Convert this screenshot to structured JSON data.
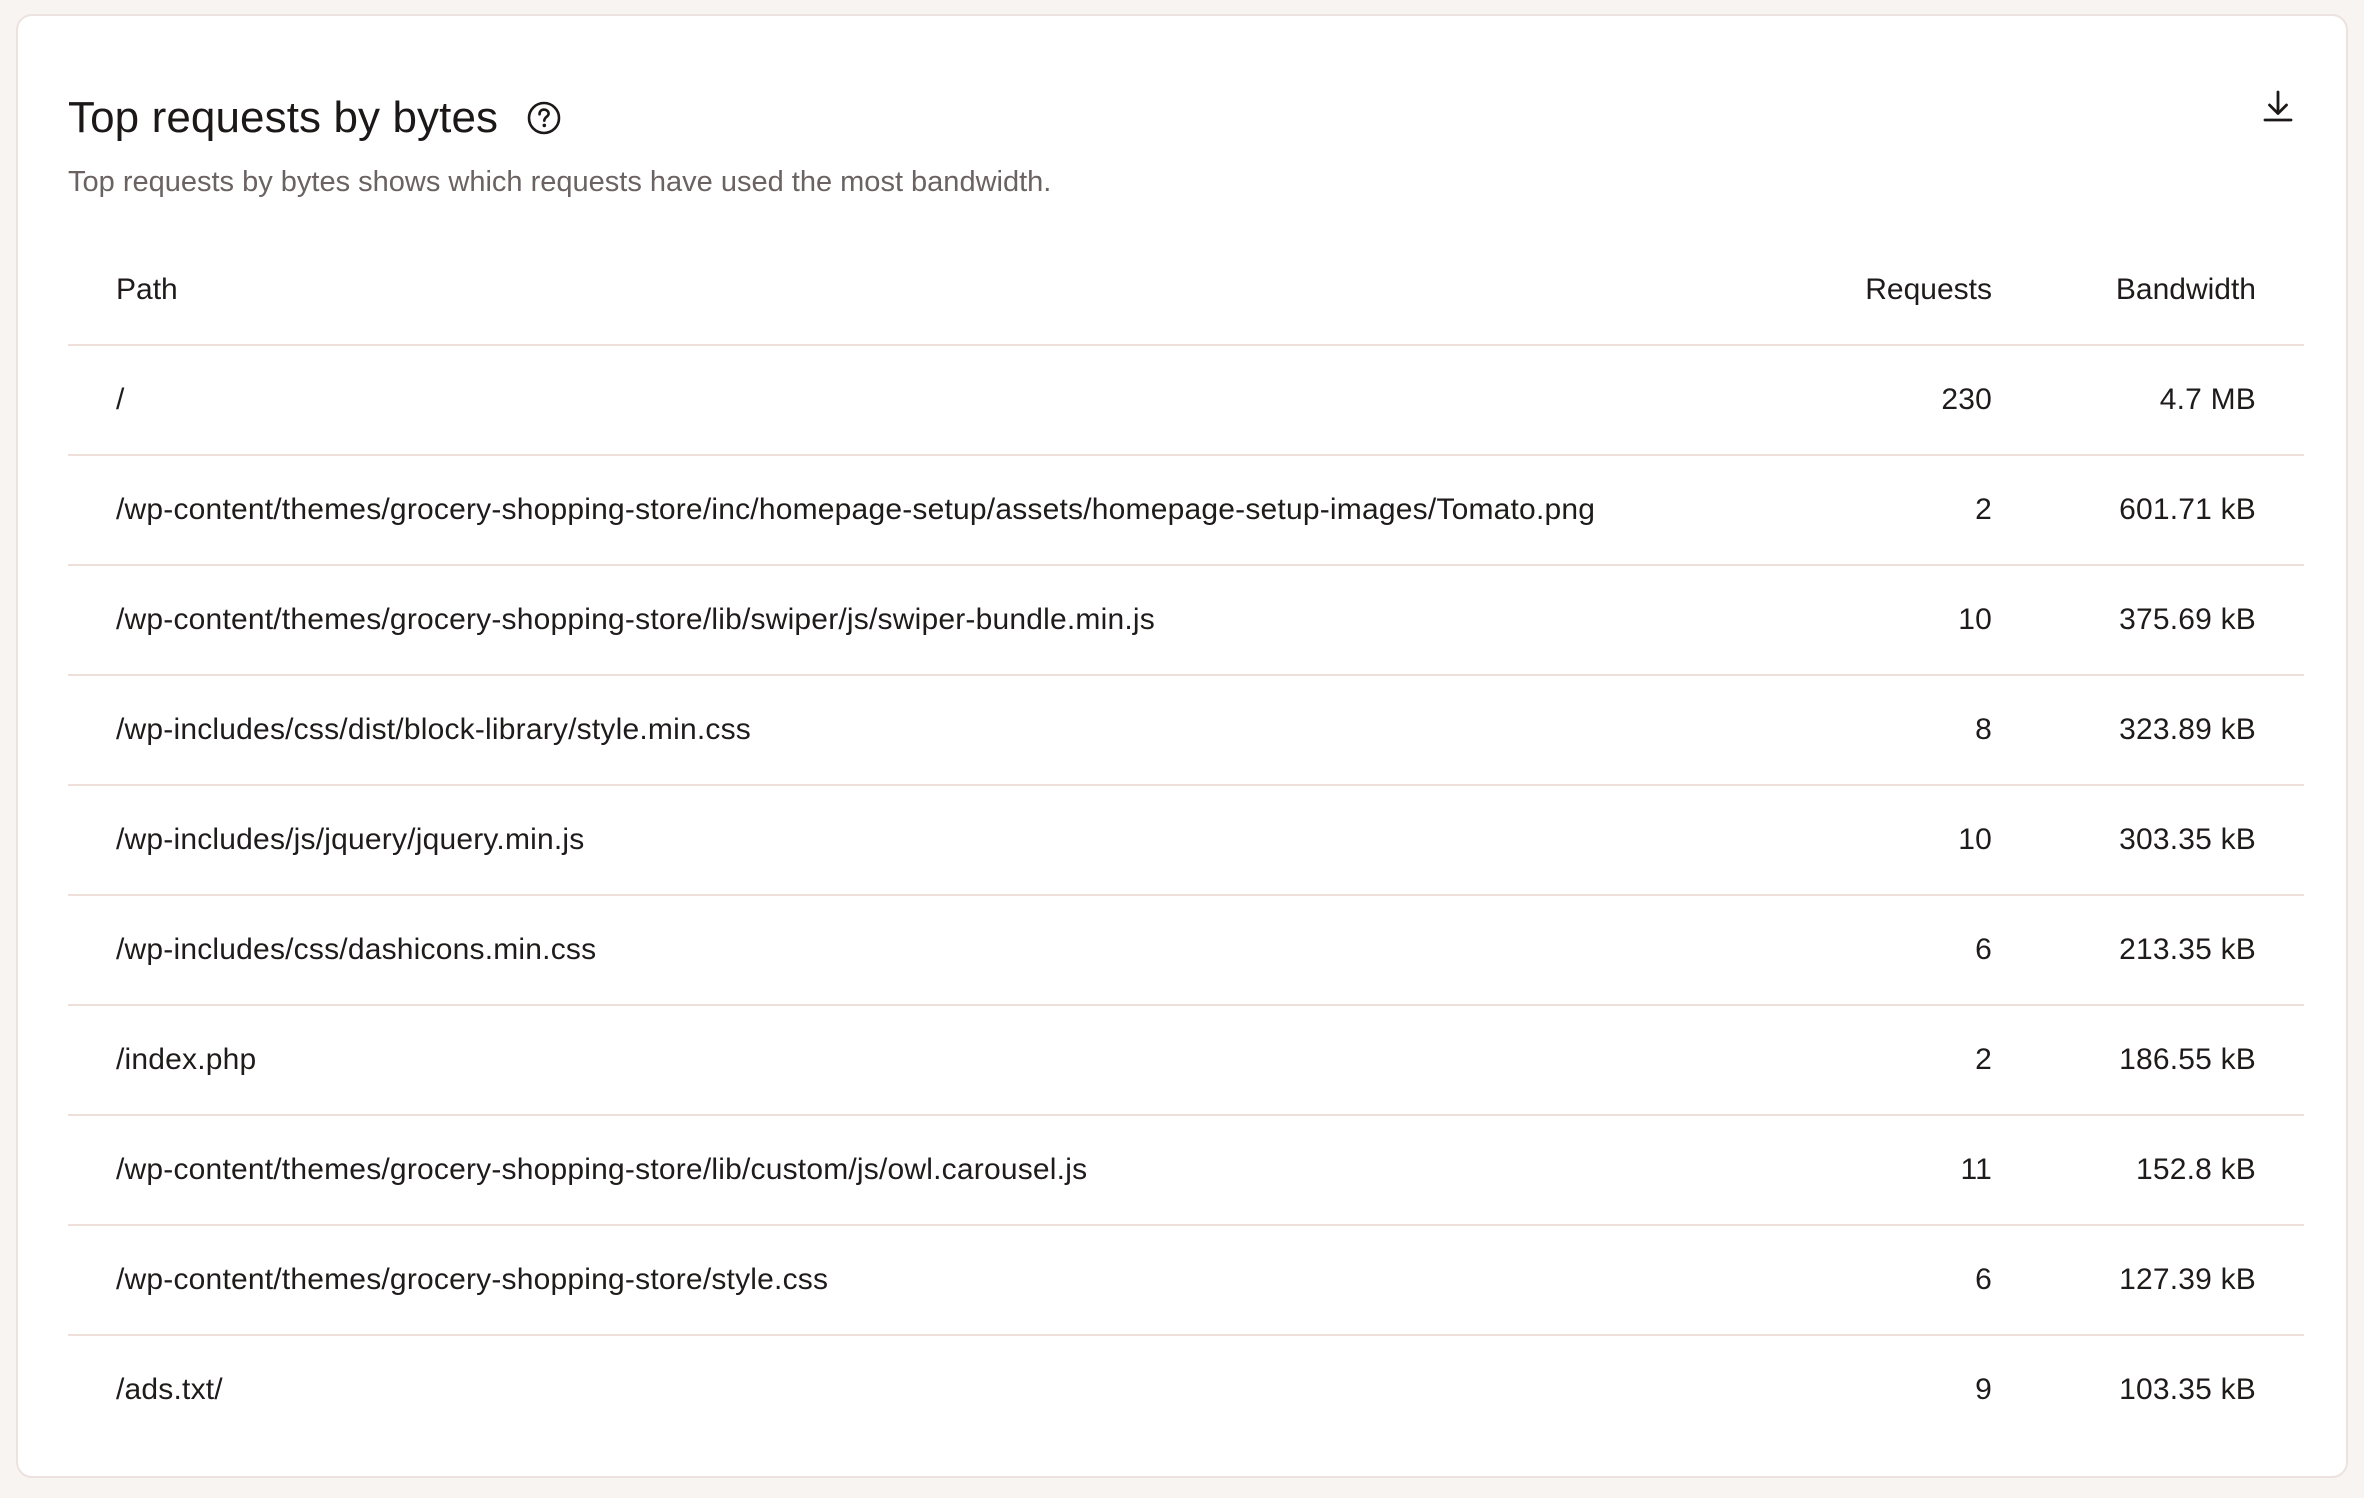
{
  "card": {
    "title": "Top requests by bytes",
    "description": "Top requests by bytes shows which requests have used the most bandwidth.",
    "help_icon": "question-circle-icon",
    "download_icon": "download-icon"
  },
  "table": {
    "columns": {
      "path": "Path",
      "requests": "Requests",
      "bandwidth": "Bandwidth"
    },
    "rows": [
      {
        "path": "/",
        "requests": "230",
        "bandwidth": "4.7 MB"
      },
      {
        "path": "/wp-content/themes/grocery-shopping-store/inc/homepage-setup/assets/homepage-setup-images/Tomato.png",
        "requests": "2",
        "bandwidth": "601.71 kB"
      },
      {
        "path": "/wp-content/themes/grocery-shopping-store/lib/swiper/js/swiper-bundle.min.js",
        "requests": "10",
        "bandwidth": "375.69 kB"
      },
      {
        "path": "/wp-includes/css/dist/block-library/style.min.css",
        "requests": "8",
        "bandwidth": "323.89 kB"
      },
      {
        "path": "/wp-includes/js/jquery/jquery.min.js",
        "requests": "10",
        "bandwidth": "303.35 kB"
      },
      {
        "path": "/wp-includes/css/dashicons.min.css",
        "requests": "6",
        "bandwidth": "213.35 kB"
      },
      {
        "path": "/index.php",
        "requests": "2",
        "bandwidth": "186.55 kB"
      },
      {
        "path": "/wp-content/themes/grocery-shopping-store/lib/custom/js/owl.carousel.js",
        "requests": "11",
        "bandwidth": "152.8 kB"
      },
      {
        "path": "/wp-content/themes/grocery-shopping-store/style.css",
        "requests": "6",
        "bandwidth": "127.39 kB"
      },
      {
        "path": "/ads.txt/",
        "requests": "9",
        "bandwidth": "103.35 kB"
      }
    ]
  },
  "colors": {
    "background": "#f8f4f2",
    "card": "#ffffff",
    "divider": "#efdfdb",
    "text": "#1f1b1b",
    "muted_text": "#6b6262"
  }
}
